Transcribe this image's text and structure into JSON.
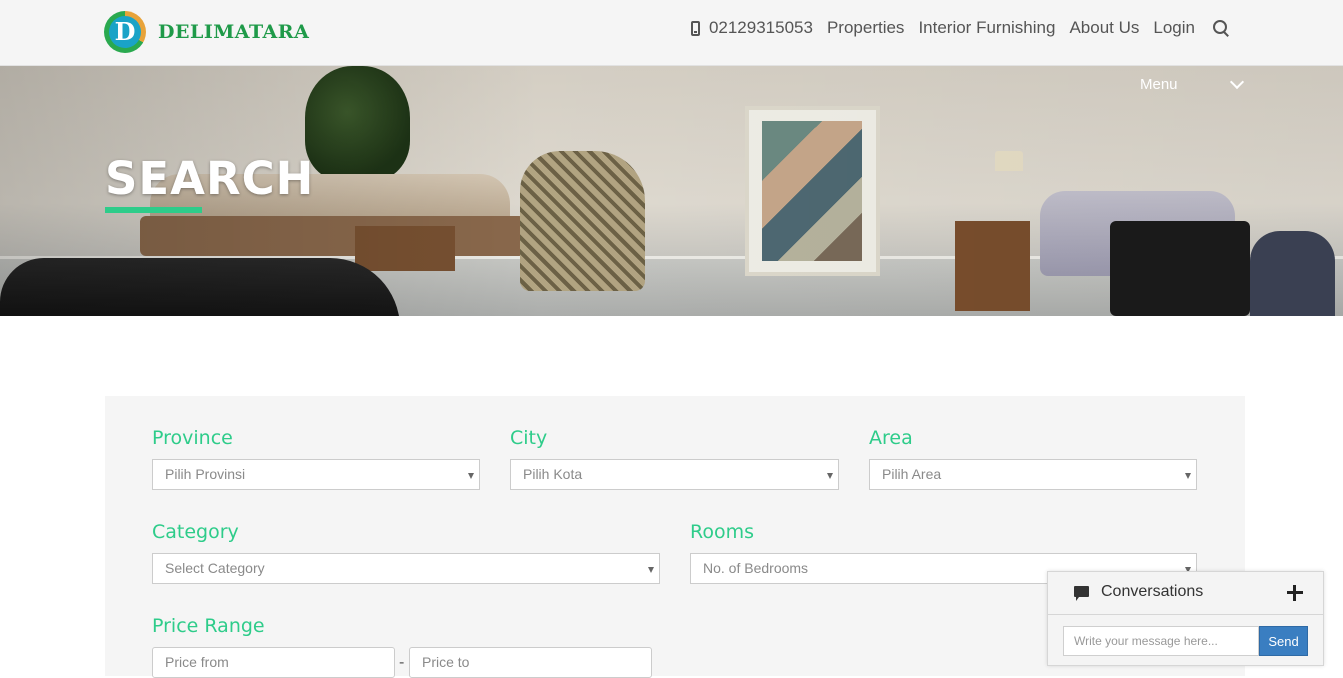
{
  "header": {
    "logo_letter": "D",
    "brand": "DELIMATARA",
    "nav": {
      "phone": "02129315053",
      "properties": "Properties",
      "interior": "Interior Furnishing",
      "about": "About Us",
      "login": "Login"
    },
    "search_icon": "search-icon",
    "phone_icon": "mobile-phone-icon"
  },
  "hero": {
    "title": "SEARCH",
    "menu_label": "Menu",
    "accent_color": "#2ecc8a"
  },
  "search_form": {
    "province": {
      "label": "Province",
      "value": "Pilih Provinsi"
    },
    "city": {
      "label": "City",
      "value": "Pilih Kota"
    },
    "area": {
      "label": "Area",
      "value": "Pilih Area"
    },
    "category": {
      "label": "Category",
      "value": "Select Category"
    },
    "rooms": {
      "label": "Rooms",
      "value": "No. of Bedrooms"
    },
    "price": {
      "label": "Price Range",
      "from_placeholder": "Price from",
      "separator": "-",
      "to_placeholder": "Price to"
    }
  },
  "chat": {
    "title": "Conversations",
    "input_placeholder": "Write your message here...",
    "send_label": "Send",
    "button_color": "#3a7ec1"
  }
}
